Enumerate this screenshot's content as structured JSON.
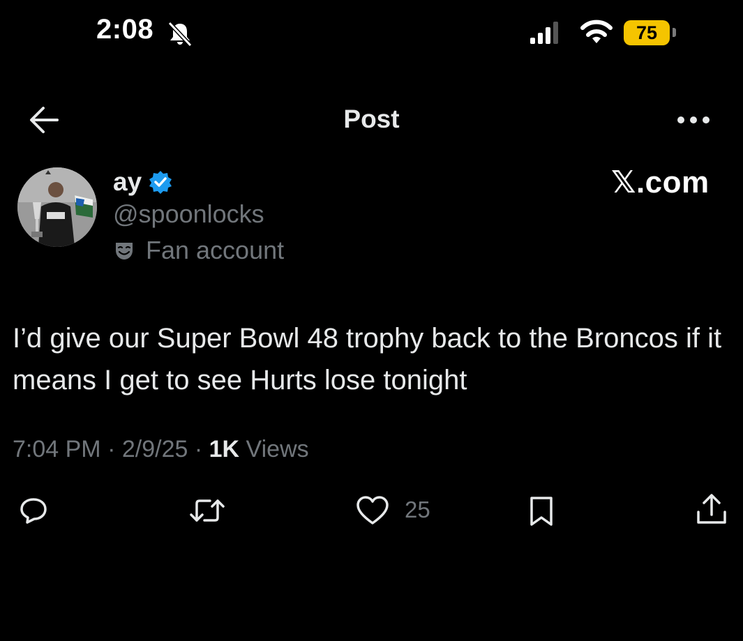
{
  "status_bar": {
    "time": "2:08",
    "battery": "75",
    "icons": [
      "bell-slash-icon",
      "signal-icon",
      "wifi-icon",
      "battery-icon"
    ]
  },
  "header": {
    "title": "Post",
    "back_icon": "arrow-left-icon",
    "more_icon": "more-horizontal-icon"
  },
  "post": {
    "author": {
      "display_name": "ay",
      "handle": "@spoonlocks",
      "label": "Fan account",
      "verified": true
    },
    "watermark": "𝕏.com",
    "text": "I’d give our Super Bowl 48 trophy back to the Broncos if it means I get to see Hurts lose tonight",
    "time": "7:04 PM",
    "date": "2/9/25",
    "sep": "·",
    "views_count": "1K",
    "views_label": "Views"
  },
  "actions": {
    "like_count": "25",
    "icons": [
      "reply-icon",
      "retweet-icon",
      "heart-icon",
      "bookmark-icon",
      "share-icon"
    ]
  },
  "colors": {
    "background": "#000000",
    "text_primary": "#e7e9ea",
    "text_secondary": "#71767b",
    "verified_blue": "#1d9bf0",
    "battery_yellow": "#f5c400"
  }
}
